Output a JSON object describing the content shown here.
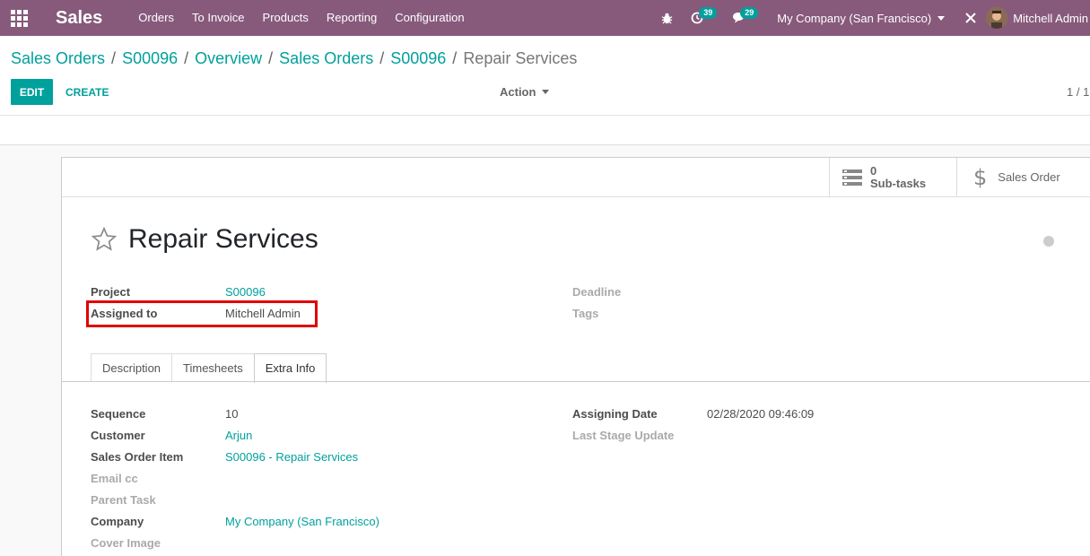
{
  "navbar": {
    "brand": "Sales",
    "menu": [
      "Orders",
      "To Invoice",
      "Products",
      "Reporting",
      "Configuration"
    ],
    "activities_count": "39",
    "messages_count": "29",
    "company": "My Company (San Francisco)",
    "user": "Mitchell Admin",
    "accent_color": "#875a7b"
  },
  "breadcrumb": {
    "links": [
      "Sales Orders",
      "S00096",
      "Overview",
      "Sales Orders",
      "S00096"
    ],
    "separator": "/",
    "current": "Repair Services"
  },
  "toolbar": {
    "edit_label": "EDIT",
    "create_label": "CREATE",
    "action_label": "Action",
    "pager": "1 / 1"
  },
  "smart_buttons": {
    "subtasks_value": "0",
    "subtasks_label": "Sub-tasks",
    "sales_order_label": "Sales Order"
  },
  "record": {
    "title": "Repair Services",
    "project_label": "Project",
    "project_value": "S00096",
    "assigned_label": "Assigned to",
    "assigned_value": "Mitchell Admin",
    "deadline_label": "Deadline",
    "tags_label": "Tags"
  },
  "tabs": {
    "items": [
      "Description",
      "Timesheets",
      "Extra Info"
    ],
    "active": "Extra Info"
  },
  "extra_info": {
    "sequence_label": "Sequence",
    "sequence_value": "10",
    "customer_label": "Customer",
    "customer_value": "Arjun",
    "sale_line_label": "Sales Order Item",
    "sale_line_value": "S00096 - Repair Services",
    "email_cc_label": "Email cc",
    "parent_task_label": "Parent Task",
    "company_label": "Company",
    "company_value": "My Company (San Francisco)",
    "cover_image_label": "Cover Image",
    "assign_date_label": "Assigning Date",
    "assign_date_value": "02/28/2020 09:46:09",
    "last_stage_label": "Last Stage Update"
  }
}
